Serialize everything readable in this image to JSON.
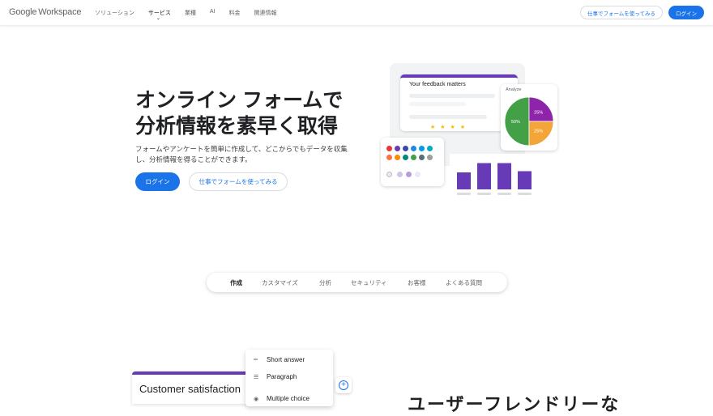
{
  "nav": {
    "logo_google": "Google",
    "logo_workspace": "Workspace",
    "items": [
      "ソリューション",
      "サービス",
      "業種",
      "AI",
      "料金",
      "関連情報"
    ],
    "cta_outline": "仕事でフォームを使ってみる",
    "cta_solid": "ログイン"
  },
  "hero": {
    "title_line1": "オンライン フォームで",
    "title_line2": "分析情報を素早く取得",
    "desc_line1": "フォームやアンケートを簡単に作成して、どこからでもデータを収集",
    "desc_line2": "し、分析情報を得ることができます。",
    "cta_solid": "ログイン",
    "cta_outline": "仕事でフォームを使ってみる"
  },
  "illustration": {
    "form_title": "Your feedback matters",
    "stars": "★★★★",
    "pie_label": "Analyze",
    "pie_slices": [
      {
        "label": "50%",
        "value": 50,
        "color": "#43a047"
      },
      {
        "label": "25%",
        "value": 25,
        "color": "#8e24aa"
      },
      {
        "label": "25%",
        "value": 25,
        "color": "#f4a53a"
      }
    ],
    "bar_values": [
      0.42,
      0.65,
      0.65,
      0.45
    ],
    "colors": {
      "accent": "#673ab7",
      "bar": "#673ab7"
    }
  },
  "tabs": [
    "作成",
    "カスタマイズ",
    "分析",
    "セキュリティ",
    "お客様",
    "よくある質問"
  ],
  "bottom": {
    "card_title": "Customer satisfaction",
    "menu": [
      {
        "icon": "short-answer-icon",
        "label": "Short answer"
      },
      {
        "icon": "paragraph-icon",
        "label": "Paragraph"
      },
      {
        "icon": "radio-icon",
        "label": "Multiple choice"
      }
    ],
    "heading": "ユーザーフレンドリーな"
  },
  "colors": {
    "primary": "#1a73e8",
    "purple": "#673ab7"
  }
}
